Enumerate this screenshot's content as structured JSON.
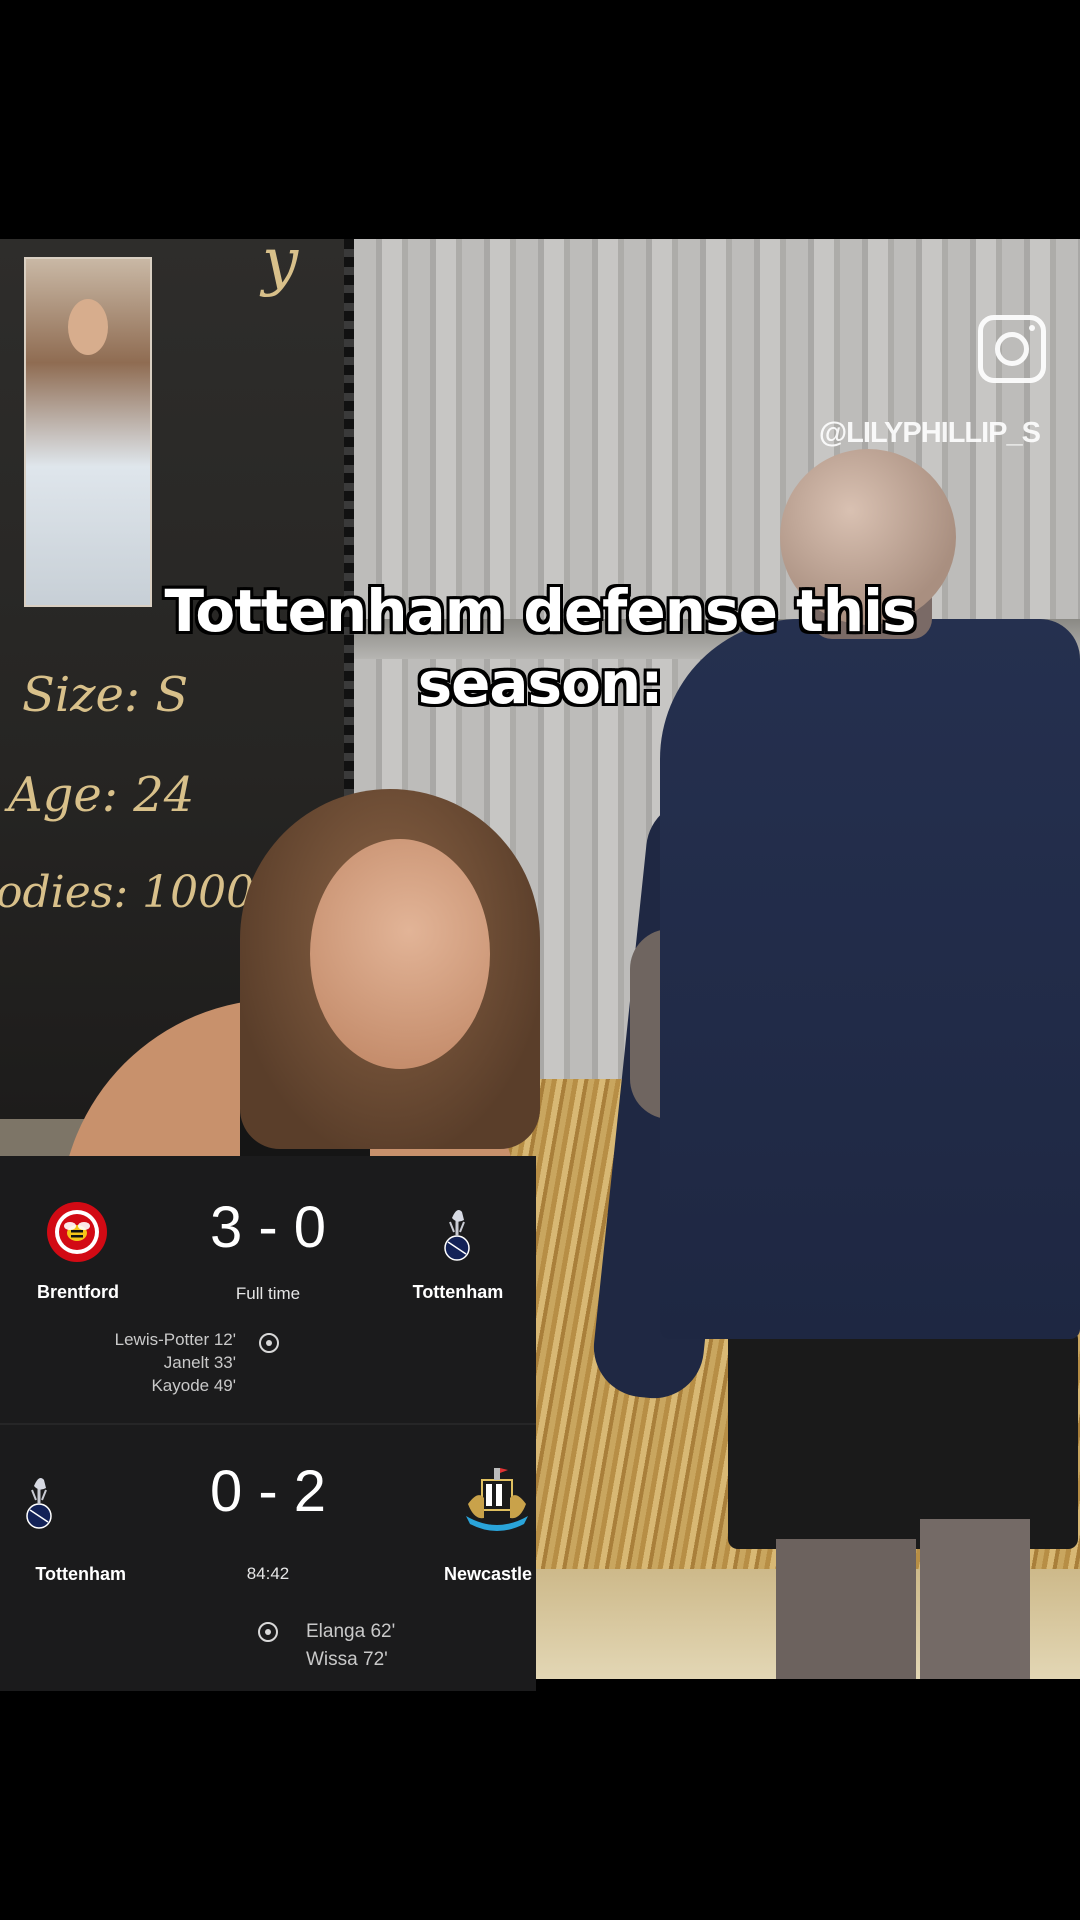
{
  "caption": {
    "line1": "Tottenham defense this",
    "line2": "season:"
  },
  "watermark": {
    "icon": "instagram-icon",
    "handle": "@LILYPHILLIP_S"
  },
  "board_text": {
    "title_fragment": "y",
    "size": "Size: S",
    "age": "Age: 24",
    "bodies": "odies: 1000+"
  },
  "matches": [
    {
      "home": "Brentford",
      "away": "Tottenham",
      "score": "3 - 0",
      "status": "Full time",
      "home_scorers": [
        "Lewis-Potter 12'",
        "Janelt 33'",
        "Kayode 49'"
      ],
      "away_scorers": []
    },
    {
      "home": "Tottenham",
      "away": "Newcastle",
      "score": "0 - 2",
      "status": "84:42",
      "home_scorers": [],
      "away_scorers": [
        "Elanga 62'",
        "Wissa 72'"
      ]
    }
  ],
  "colors": {
    "brentford_red": "#d20a14",
    "tottenham_navy": "#132257",
    "overlay_bg": "#1b1b1c"
  }
}
